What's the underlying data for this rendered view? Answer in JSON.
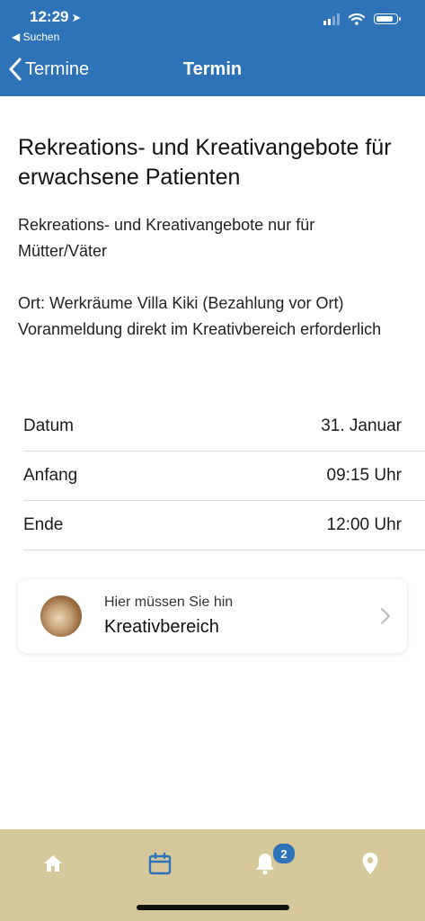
{
  "status_bar": {
    "time": "12:29",
    "back_app": "◀ Suchen"
  },
  "nav": {
    "back_label": "Termine",
    "title": "Termin"
  },
  "event": {
    "title": "Rekreations- und Kreativangebote für erwachsene Patienten",
    "description": "Rekreations- und Kreativangebote nur für Mütter/Väter",
    "location_note": "Ort: Werkräume Villa Kiki (Bezahlung vor Ort) Voranmeldung direkt im Kreativbereich erforderlich"
  },
  "details": [
    {
      "label": "Datum",
      "value": "31. Januar"
    },
    {
      "label": "Anfang",
      "value": "09:15 Uhr"
    },
    {
      "label": "Ende",
      "value": "12:00 Uhr"
    }
  ],
  "location_card": {
    "subtitle": "Hier müssen Sie hin",
    "name": "Kreativbereich"
  },
  "tabbar": {
    "items": [
      {
        "icon": "home-icon"
      },
      {
        "icon": "calendar-icon",
        "active": true
      },
      {
        "icon": "bell-icon",
        "badge": "2"
      },
      {
        "icon": "map-pin-icon"
      }
    ],
    "colors": {
      "background": "#d6c89b",
      "active": "#2e73b8",
      "inactive": "#ffffff"
    }
  },
  "colors": {
    "accent": "#2e73b8"
  }
}
